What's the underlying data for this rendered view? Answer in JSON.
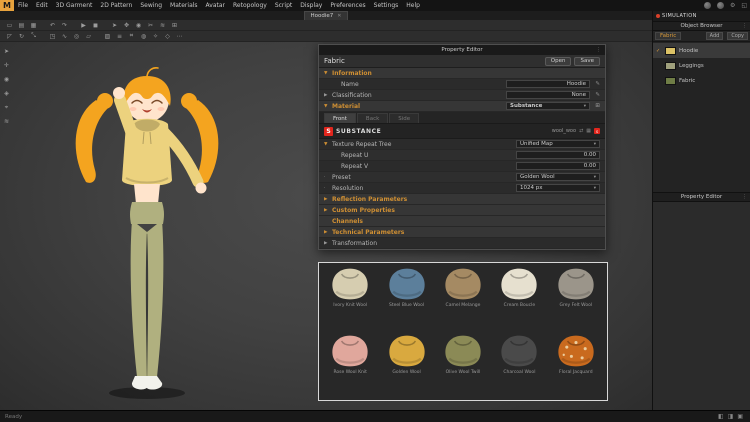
{
  "app": {
    "logo": "M",
    "file_tab": "Hoodie7",
    "simulation_badge": "SIMULATION",
    "status_left": "Ready",
    "accent": "#e8a33d"
  },
  "menubar": {
    "items": [
      "File",
      "Edit",
      "3D Garment",
      "2D Pattern",
      "Sewing",
      "Materials",
      "Avatar",
      "Retopology",
      "Script",
      "Display",
      "Preferences",
      "Settings",
      "Help"
    ]
  },
  "object_browser": {
    "title": "Object Browser",
    "tab": "Fabric",
    "add_label": "Add",
    "copy_label": "Copy",
    "items": [
      {
        "name": "Hoodie",
        "color": "#dcc266",
        "check": "✓"
      },
      {
        "name": "Leggings",
        "color": "#9fa07c",
        "check": ""
      },
      {
        "name": "Fabric",
        "color": "#6f7d46",
        "check": ""
      }
    ],
    "lower_title": "Property Editor"
  },
  "property_editor": {
    "title": "Property Editor",
    "type_label": "Fabric",
    "open_label": "Open",
    "save_label": "Save",
    "information": {
      "header": "Information",
      "name_label": "Name",
      "name_value": "Hoodie",
      "classification_label": "Classification",
      "classification_value": "None"
    },
    "material": {
      "header": "Material",
      "type_value": "Substance",
      "tabs": [
        "Front",
        "Back",
        "Side"
      ],
      "brand": "SUBSTANCE",
      "file": "wool_woo",
      "texture_repeat_label": "Texture Repeat Tree",
      "texture_repeat_value": "Unified Map",
      "repeat_u_label": "Repeat U",
      "repeat_u_value": "0.00",
      "repeat_v_label": "Repeat V",
      "repeat_v_value": "0.00",
      "preset_label": "Preset",
      "preset_value": "Golden Wool",
      "resolution_label": "Resolution",
      "resolution_value": "1024 px",
      "reflection_header": "Reflection Parameters",
      "custom_header": "Custom Properties"
    },
    "channels_header": "Channels",
    "technical_header": "Technical Parameters",
    "transformation_header": "Transformation"
  },
  "material_grid": {
    "items": [
      {
        "name": "Ivory Knit Wool",
        "color": "#d6cdb0"
      },
      {
        "name": "Steel Blue Wool",
        "color": "#5c7f9b"
      },
      {
        "name": "Camel Melange",
        "color": "#a58a63"
      },
      {
        "name": "Cream Boucle",
        "color": "#e6e0cf"
      },
      {
        "name": "Grey Felt Wool",
        "color": "#9b958a"
      },
      {
        "name": "Rose Wool Knit",
        "color": "#e0a79c"
      },
      {
        "name": "Golden Wool",
        "color": "#d9a93f"
      },
      {
        "name": "Olive Wool Twill",
        "color": "#8b8a56"
      },
      {
        "name": "Charcoal Wool",
        "color": "#4a4a4a"
      },
      {
        "name": "Floral Jacquard",
        "color": "#c96a1e"
      }
    ]
  },
  "avatar": {
    "hair_color": "#f4a41f",
    "skin_color": "#ffe4cc",
    "hoodie_color": "#ecd27e",
    "leggings_color": "#b0b07f",
    "shoe_color": "#f2f2ec"
  }
}
